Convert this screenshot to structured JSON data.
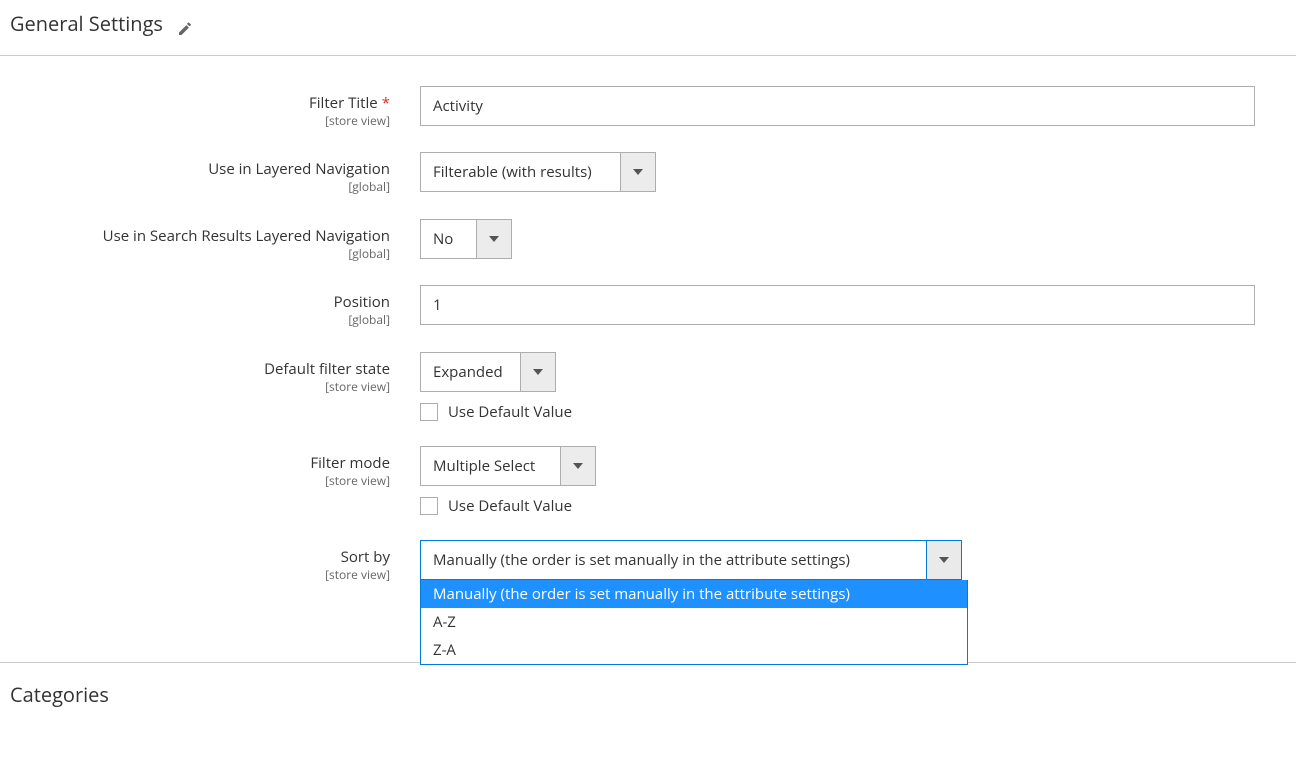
{
  "section_title": "General Settings",
  "scope_store_view": "[store view]",
  "scope_global": "[global]",
  "fields": {
    "filter_title": {
      "label": "Filter Title",
      "required": true,
      "value": "Activity"
    },
    "layered_nav": {
      "label": "Use in Layered Navigation",
      "value": "Filterable (with results)"
    },
    "search_layered_nav": {
      "label": "Use in Search Results Layered Navigation",
      "value": "No"
    },
    "position": {
      "label": "Position",
      "value": "1"
    },
    "default_state": {
      "label": "Default filter state",
      "value": "Expanded"
    },
    "filter_mode": {
      "label": "Filter mode",
      "value": "Multiple Select"
    },
    "sort_by": {
      "label": "Sort by",
      "value": "Manually (the order is set manually in the attribute settings)",
      "options": [
        "Manually (the order is set manually in the attribute settings)",
        "A-Z",
        "Z-A"
      ]
    }
  },
  "use_default_label": "Use Default Value",
  "categories_title": "Categories"
}
